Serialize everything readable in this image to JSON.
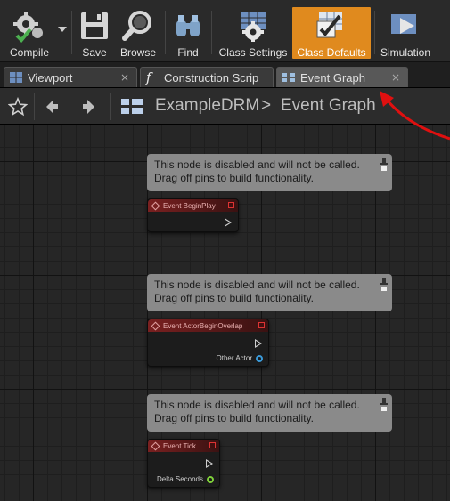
{
  "toolbar": {
    "compile": "Compile",
    "save": "Save",
    "browse": "Browse",
    "find": "Find",
    "class_settings": "Class Settings",
    "class_defaults": "Class Defaults",
    "simulation": "Simulation"
  },
  "tabs": [
    {
      "label": "Viewport",
      "close": "×"
    },
    {
      "label": "Construction Scrip",
      "close": "×"
    },
    {
      "label": "Event Graph",
      "close": "×"
    }
  ],
  "breadcrumb": {
    "root": "ExampleDRM",
    "separator": ">",
    "current": "Event Graph"
  },
  "graph": {
    "comment_text": "This node is disabled and will not be called.\nDrag off pins to build functionality.",
    "nodes": [
      {
        "title": "Event BeginPlay"
      },
      {
        "title": "Event ActorBeginOverlap",
        "out_pin": "Other Actor"
      },
      {
        "title": "Event Tick",
        "out_pin": "Delta Seconds"
      }
    ]
  },
  "colors": {
    "active_button": "#e08a1e",
    "annotation_arrow": "#e01010",
    "event_header": "#7a2020",
    "object_pin": "#3a9ad9",
    "float_pin": "#7fd03a"
  },
  "icons": [
    "compile-icon",
    "save-icon",
    "browse-icon",
    "find-icon",
    "class-settings-icon",
    "class-defaults-icon",
    "simulation-icon",
    "star-icon",
    "back-arrow-icon",
    "forward-arrow-icon",
    "graph-icon",
    "pin-icon"
  ]
}
